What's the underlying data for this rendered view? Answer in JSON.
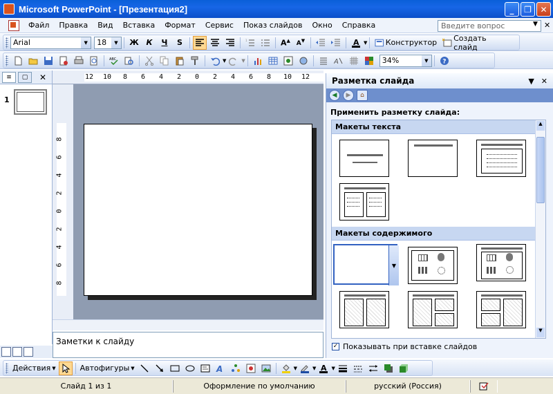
{
  "window": {
    "title": "Microsoft PowerPoint - [Презентация2]"
  },
  "menu": {
    "items": [
      "Файл",
      "Правка",
      "Вид",
      "Вставка",
      "Формат",
      "Сервис",
      "Показ слайдов",
      "Окно",
      "Справка"
    ],
    "ask_placeholder": "Введите вопрос"
  },
  "formatting": {
    "font": "Arial",
    "size": "18",
    "bold": "Ж",
    "italic": "К",
    "underline": "Ч",
    "shadow": "S",
    "designer": "Конструктор",
    "new_slide": "Создать слайд"
  },
  "standard": {
    "zoom": "34%"
  },
  "slides_pane": {
    "slide_number": "1"
  },
  "ruler": {
    "h": [
      "12",
      "10",
      "8",
      "6",
      "4",
      "2",
      "0",
      "2",
      "4",
      "6",
      "8",
      "10",
      "12"
    ],
    "v": [
      "8",
      "6",
      "4",
      "2",
      "0",
      "2",
      "4",
      "6",
      "8"
    ]
  },
  "notes": {
    "text": "Заметки к слайду"
  },
  "task_pane": {
    "title": "Разметка слайда",
    "apply_label": "Применить разметку слайда:",
    "section_text": "Макеты текста",
    "section_content": "Макеты содержимого",
    "checkbox_label": "Показывать при вставке слайдов",
    "checkbox_checked": true
  },
  "drawing": {
    "actions": "Действия",
    "autoshapes": "Автофигуры"
  },
  "status": {
    "slide": "Слайд 1 из 1",
    "design": "Оформление по умолчанию",
    "language": "русский (Россия)"
  }
}
